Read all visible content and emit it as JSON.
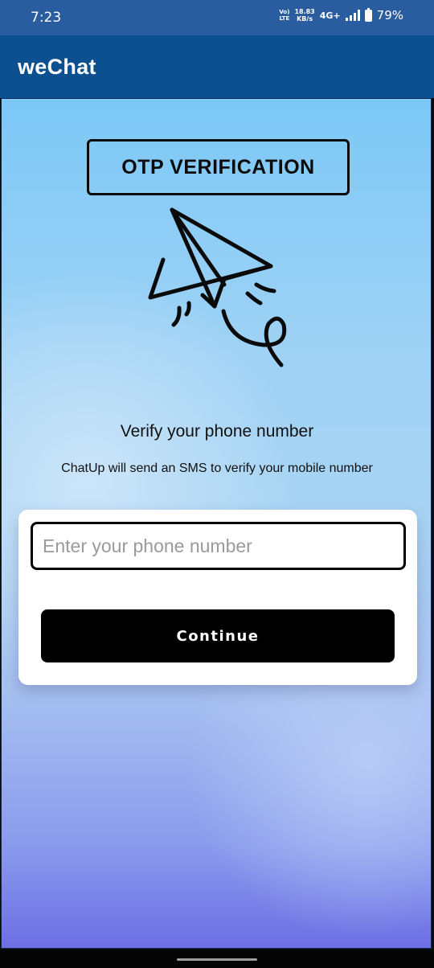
{
  "status_bar": {
    "time": "7:23",
    "volte_top": "Vo)",
    "volte_bottom": "LTE",
    "speed_value": "18.83",
    "speed_unit": "KB/s",
    "network": "4G+",
    "battery": "79%",
    "battery_level_percent": 79
  },
  "app_bar": {
    "title": "weChat"
  },
  "otp": {
    "heading": "OTP VERIFICATION",
    "illustration": "paper-plane-icon"
  },
  "verify": {
    "title": "Verify your phone number",
    "subtitle": "ChatUp will send an SMS to verify your mobile number"
  },
  "form": {
    "phone_value": "",
    "phone_placeholder": "Enter your phone number",
    "continue_label": "Continue"
  },
  "colors": {
    "status_bar": "#2a5da0",
    "app_bar": "#0d5090",
    "button": "#000000",
    "button_text": "#ffffff"
  }
}
